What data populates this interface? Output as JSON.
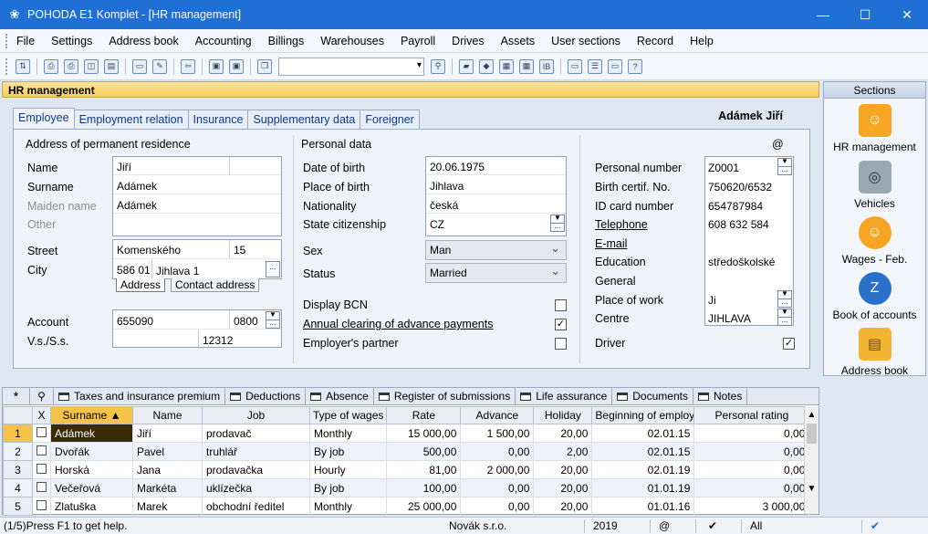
{
  "window": {
    "title": "POHODA E1 Komplet - [HR management]"
  },
  "menu": [
    "File",
    "Settings",
    "Address book",
    "Accounting",
    "Billings",
    "Warehouses",
    "Payroll",
    "Drives",
    "Assets",
    "User sections",
    "Record",
    "Help"
  ],
  "agenda": {
    "title": "HR management",
    "person": "Adámek Jiří",
    "at": "@"
  },
  "tabs": [
    "Employee",
    "Employment relation",
    "Insurance",
    "Supplementary data",
    "Foreigner"
  ],
  "address": {
    "section": "Address of permanent residence",
    "labels": {
      "name": "Name",
      "surname": "Surname",
      "maiden": "Maiden name",
      "other": "Other",
      "street": "Street",
      "city": "City",
      "account": "Account",
      "vs": "V.s./S.s."
    },
    "name": "Jiří",
    "surname": "Adámek",
    "maiden": "Adámek",
    "street": "Komenského",
    "street_no": "15",
    "zip": "586 01",
    "city": "Jihlava 1",
    "subtabs": [
      "Address",
      "Contact address"
    ],
    "account": "655090",
    "bank": "0800",
    "ss": "12312"
  },
  "personal": {
    "section": "Personal data",
    "labels": {
      "dob": "Date of birth",
      "pob": "Place of birth",
      "nat": "Nationality",
      "cit": "State citizenship",
      "sex": "Sex",
      "status": "Status",
      "bcn": "Display BCN",
      "annual": "Annual clearing of advance payments",
      "partner": "Employer's partner"
    },
    "dob": "20.06.1975",
    "pob": "Jihlava",
    "nat": "česká",
    "cit": "CZ",
    "sex": "Man",
    "status": "Married"
  },
  "ident": {
    "labels": {
      "pn": "Personal number",
      "bc": "Birth certif. No.",
      "id": "ID card number",
      "tel": "Telephone",
      "email": "E-mail",
      "edu": "Education",
      "gen": "General",
      "pow": "Place of work",
      "centre": "Centre",
      "driver": "Driver"
    },
    "pn": "Z0001",
    "bc": "750620/6532",
    "id": "654787984",
    "tel": "608 632 584",
    "edu": "středoškolské",
    "pow": "Ji",
    "centre": "JIHLAVA"
  },
  "sections": {
    "title": "Sections",
    "items": [
      "HR management",
      "Vehicles",
      "Wages - Feb.",
      "Book of accounts",
      "Address book"
    ]
  },
  "gridtabs": [
    "Taxes and insurance premium",
    "Deductions",
    "Absence",
    "Register of submissions",
    "Life assurance",
    "Documents",
    "Notes"
  ],
  "grid": {
    "headers": [
      "X",
      "Surname",
      "Name",
      "Job",
      "Type of wages",
      "Rate",
      "Advance",
      "Holiday",
      "Beginning of employ",
      "Personal rating"
    ],
    "rows": [
      [
        "1",
        "Adámek",
        "Jiří",
        "prodavač",
        "Monthly",
        "15 000,00",
        "1 500,00",
        "20,00",
        "02.01.15",
        "0,00"
      ],
      [
        "2",
        "Dvořák",
        "Pavel",
        "truhlář",
        "By job",
        "500,00",
        "0,00",
        "2,00",
        "02.01.15",
        "0,00"
      ],
      [
        "3",
        "Horská",
        "Jana",
        "prodavačka",
        "Hourly",
        "81,00",
        "2 000,00",
        "20,00",
        "02.01.19",
        "0,00"
      ],
      [
        "4",
        "Večeřová",
        "Markéta",
        "uklízečka",
        "By job",
        "100,00",
        "0,00",
        "20,00",
        "01.01.19",
        "0,00"
      ],
      [
        "5",
        "Zlatuška",
        "Marek",
        "obchodní ředitel",
        "Monthly",
        "25 000,00",
        "0,00",
        "20,00",
        "01.01.16",
        "3 000,00"
      ]
    ]
  },
  "status": {
    "help": "(1/5)Press F1 to get help.",
    "company": "Novák s.r.o.",
    "year": "2019",
    "at": "@",
    "all": "All"
  }
}
